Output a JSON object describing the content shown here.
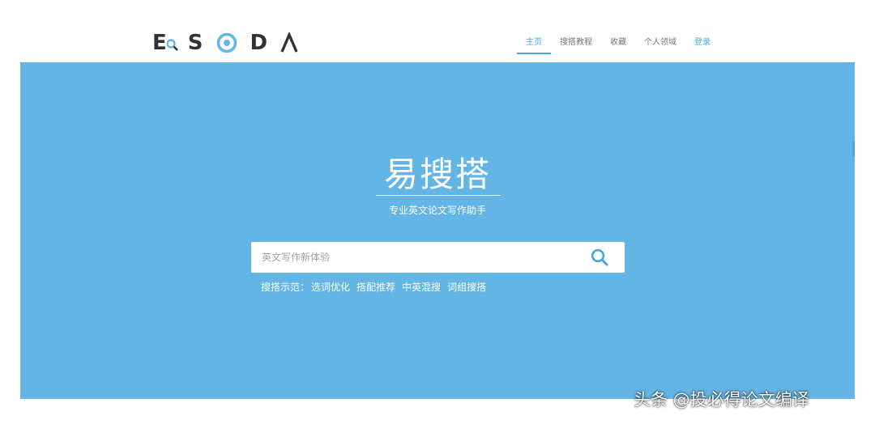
{
  "logo": {
    "letters": [
      "E",
      "S",
      "D",
      "A"
    ]
  },
  "nav": {
    "items": [
      "主页",
      "搜搭教程",
      "收藏",
      "个人领域",
      "登录"
    ],
    "active": 0
  },
  "hero": {
    "title": "易搜搭",
    "subtitle": "专业英文论文写作助手"
  },
  "search": {
    "placeholder": "英文写作新体验",
    "value": "",
    "icon": "search-icon"
  },
  "examples": {
    "label": "搜搭示范：",
    "links": [
      "选词优化",
      "搭配推荐",
      "中英混搜",
      "词组搜搭"
    ]
  },
  "watermark": "头条 @投必得论文编译",
  "colors": {
    "hero_bg": "#63b5e5",
    "accent": "#3ea8dc",
    "logo_dark": "#2f3338"
  }
}
